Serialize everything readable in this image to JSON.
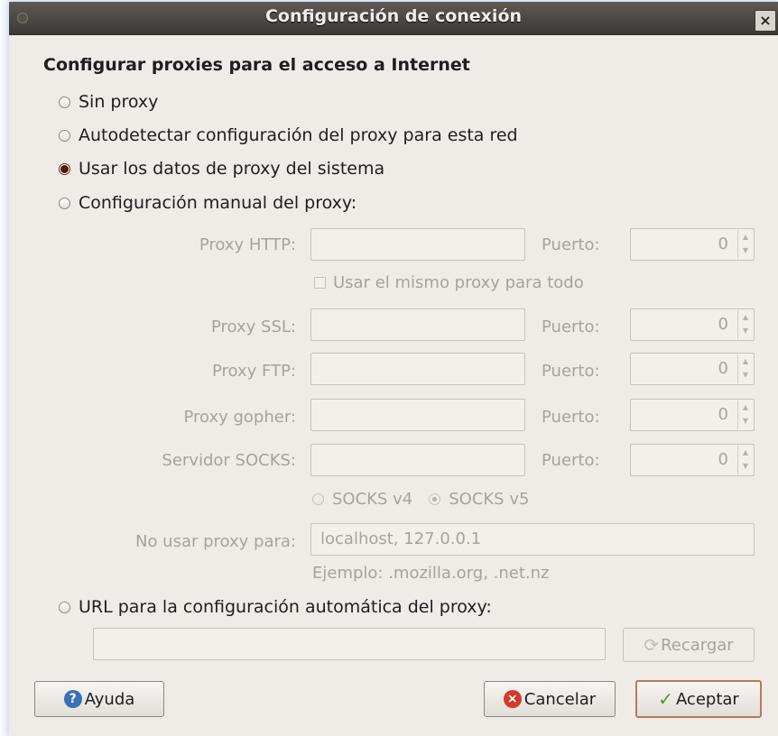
{
  "window": {
    "title": "Configuración de conexión",
    "close_glyph": "×"
  },
  "heading": "Configurar proxies para el acceso a Internet",
  "radios": {
    "no_proxy": "Sin proxy",
    "autodetect": "Autodetectar configuración del proxy para esta red",
    "system": "Usar los datos de proxy del sistema",
    "manual": "Configuración manual del proxy:",
    "auto_url": "URL para la configuración automática del proxy:"
  },
  "selected_radio": "system",
  "manual": {
    "http_label": "Proxy HTTP:",
    "http_value": "",
    "http_port_label": "Puerto:",
    "http_port": "0",
    "same_proxy_label": "Usar el mismo proxy para todo",
    "ssl_label": "Proxy SSL:",
    "ssl_value": "",
    "ssl_port_label": "Puerto:",
    "ssl_port": "0",
    "ftp_label": "Proxy FTP:",
    "ftp_value": "",
    "ftp_port_label": "Puerto:",
    "ftp_port": "0",
    "gopher_label": "Proxy gopher:",
    "gopher_value": "",
    "gopher_port_label": "Puerto:",
    "gopher_port": "0",
    "socks_label": "Servidor SOCKS:",
    "socks_value": "",
    "socks_port_label": "Puerto:",
    "socks_port": "0",
    "socks_v4": "SOCKS v4",
    "socks_v5": "SOCKS v5",
    "no_proxy_label": "No usar proxy para:",
    "no_proxy_value": "localhost, 127.0.0.1",
    "example": "Ejemplo: .mozilla.org, .net.nz"
  },
  "auto_url": {
    "value": "",
    "reload_label": "Recargar"
  },
  "buttons": {
    "help": "Ayuda",
    "cancel": "Cancelar",
    "ok": "Aceptar"
  },
  "colors": {
    "dialog_bg": "#efebe7",
    "accent_border": "#b67a5c",
    "disabled_text": "#a7a39b"
  }
}
